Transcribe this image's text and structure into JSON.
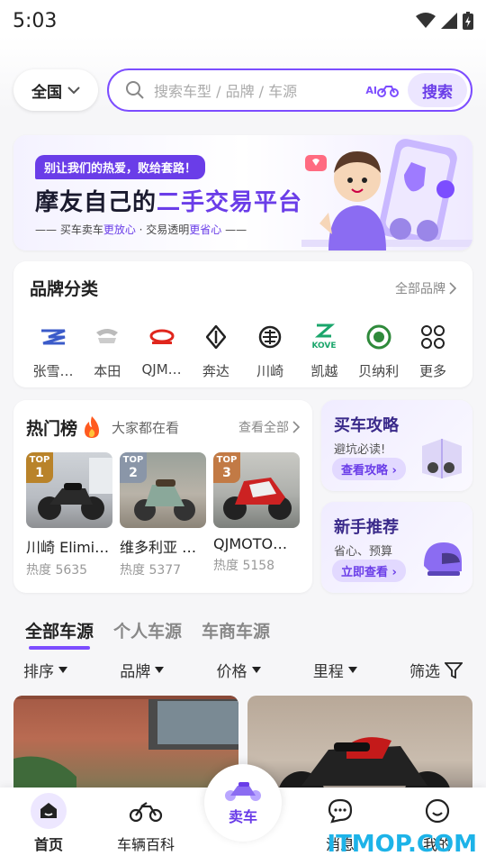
{
  "status": {
    "time": "5:03"
  },
  "search": {
    "region": "全国",
    "placeholder": "搜索车型 / 品牌 / 车源",
    "ai_label": "AI",
    "button": "搜索"
  },
  "banner": {
    "tag": "别让我们的热爱，败给套路！",
    "title_a": "摩友自己的",
    "title_b": "二手交易平台",
    "sub_a": "—— 买车卖车",
    "sub_b": "更放心",
    "sub_c": " · 交易透明",
    "sub_d": "更省心",
    "sub_e": " ——"
  },
  "brands": {
    "title": "品牌分类",
    "all": "全部品牌",
    "items": [
      {
        "name": "张雪…",
        "icon": "zhangxue-logo-icon"
      },
      {
        "name": "本田",
        "icon": "honda-logo-icon"
      },
      {
        "name": "QJM…",
        "icon": "qjmotor-logo-icon"
      },
      {
        "name": "奔达",
        "icon": "benda-logo-icon"
      },
      {
        "name": "川崎",
        "icon": "kawasaki-logo-icon"
      },
      {
        "name": "凯越",
        "icon": "kove-logo-icon"
      },
      {
        "name": "贝纳利",
        "icon": "benelli-logo-icon"
      },
      {
        "name": "更多",
        "icon": "more-grid-icon"
      }
    ],
    "kove_text": "KOVE"
  },
  "hot": {
    "title": "热门榜",
    "sub": "大家都在看",
    "all": "查看全部",
    "items": [
      {
        "badge": "TOP",
        "rank": "1",
        "name": "川崎 Elimi…",
        "heat": "热度 5635",
        "badge_color": "#b9832a"
      },
      {
        "badge": "TOP",
        "rank": "2",
        "name": "维多利亚 …",
        "heat": "热度 5377",
        "badge_color": "#8a96a8"
      },
      {
        "badge": "TOP",
        "rank": "3",
        "name": "QJMOTO…",
        "heat": "热度 5158",
        "badge_color": "#c27a45"
      }
    ]
  },
  "guide": {
    "title": "买车攻略",
    "sub": "避坑必读!",
    "button": "查看攻略"
  },
  "newbie": {
    "title": "新手推荐",
    "sub": "省心、预算",
    "button": "立即查看"
  },
  "tabs": [
    {
      "label": "全部车源",
      "active": true
    },
    {
      "label": "个人车源",
      "active": false
    },
    {
      "label": "车商车源",
      "active": false
    }
  ],
  "filters": {
    "sort": "排序",
    "brand": "品牌",
    "price": "价格",
    "mileage": "里程",
    "filter": "筛选"
  },
  "nav": {
    "home": "首页",
    "wiki": "车辆百科",
    "sell": "卖车",
    "msg": "消息",
    "me": "我的"
  },
  "watermark": "ITMOP.COM",
  "colors": {
    "accent": "#7c4dff",
    "accent_dark": "#6a3de8",
    "accent_light": "#ece6ff"
  }
}
